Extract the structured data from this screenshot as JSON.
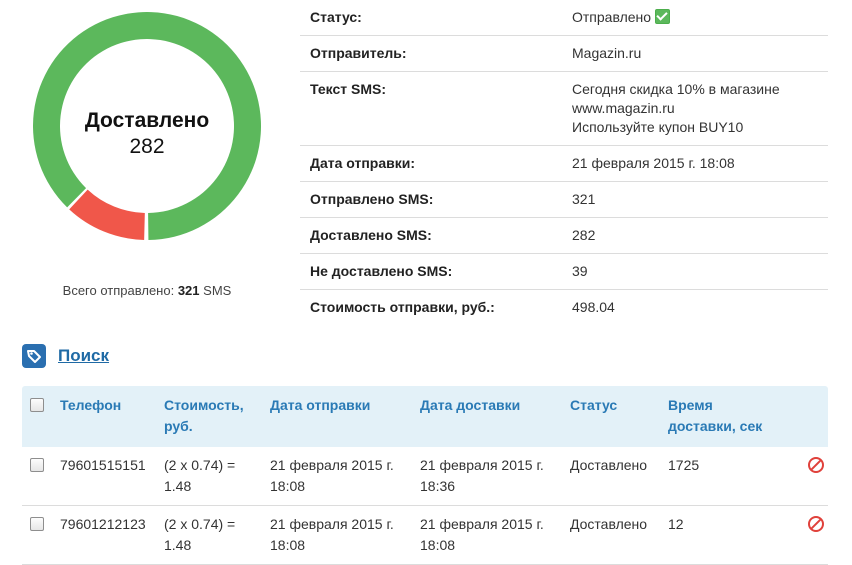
{
  "donut": {
    "title": "Доставлено",
    "value": "282",
    "delivered": 282,
    "not_delivered": 39,
    "colors": {
      "delivered": "#5cb85c",
      "not_delivered": "#f0574a"
    }
  },
  "total": {
    "prefix": "Всего отправлено:",
    "count": "321",
    "suffix": "SMS"
  },
  "details": [
    {
      "label": "Статус:",
      "value": "Отправлено"
    },
    {
      "label": "Отправитель:",
      "value": "Magazin.ru"
    },
    {
      "label": "Текст SMS:",
      "lines": [
        "Сегодня скидка 10% в магазине",
        "www.magazin.ru",
        "Используйте купон BUY10"
      ]
    },
    {
      "label": "Дата отправки:",
      "value": "21 февраля 2015 г. 18:08"
    },
    {
      "label": "Отправлено SMS:",
      "value": "321"
    },
    {
      "label": "Доставлено SMS:",
      "value": "282"
    },
    {
      "label": "Не доставлено SMS:",
      "value": "39"
    },
    {
      "label": "Стоимость отправки, руб.:",
      "value": "498.04"
    }
  ],
  "search": {
    "label": "Поиск",
    "icon": "tag-icon"
  },
  "table": {
    "headers": {
      "phone": "Телефон",
      "cost": [
        "Стоимость,",
        "руб."
      ],
      "sent": "Дата отправки",
      "delivered": "Дата доставки",
      "status": "Статус",
      "time": [
        "Время",
        "доставки, сек"
      ]
    },
    "rows": [
      {
        "phone": "79601515151",
        "cost": [
          "(2 x 0.74) =",
          "1.48"
        ],
        "sent": [
          "21 февраля 2015 г.",
          "18:08"
        ],
        "delivered": [
          "21 февраля 2015 г.",
          "18:36"
        ],
        "status": "Доставлено",
        "time": "1725"
      },
      {
        "phone": "79601212123",
        "cost": [
          "(2 x 0.74) =",
          "1.48"
        ],
        "sent": [
          "21 февраля 2015 г.",
          "18:08"
        ],
        "delivered": [
          "21 февраля 2015 г.",
          "18:08"
        ],
        "status": "Доставлено",
        "time": "12"
      }
    ]
  }
}
